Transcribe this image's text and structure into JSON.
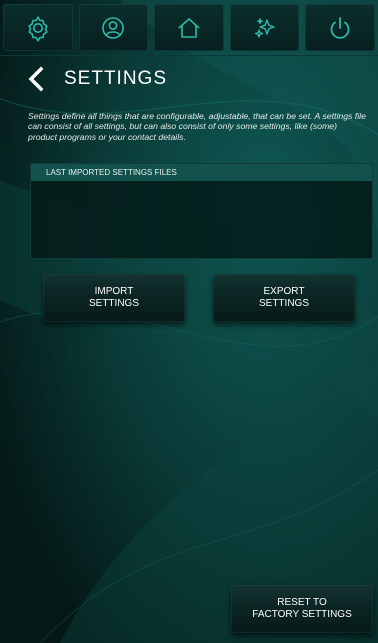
{
  "nav": {
    "items": [
      {
        "name": "gear-icon",
        "label": "Settings"
      },
      {
        "name": "user-icon",
        "label": "Profile"
      },
      {
        "name": "home-icon",
        "label": "Home"
      },
      {
        "name": "sparkle-icon",
        "label": "Effects"
      },
      {
        "name": "power-icon",
        "label": "Power"
      }
    ],
    "icon_color": "#2fb9aa"
  },
  "header": {
    "back_icon": "chevron-left-icon",
    "title": "SETTINGS"
  },
  "description": "Settings define all things that are configurable, adjustable, that can be set. A settings file can consist of all settings, but can also consist of only some settings, like (some) product programs or your contact details.",
  "files_panel": {
    "header": "LAST IMPORTED SETTINGS FILES",
    "items": []
  },
  "buttons": {
    "import": "IMPORT\nSETTINGS",
    "export": "EXPORT\nSETTINGS",
    "reset": "RESET TO\nFACTORY SETTINGS"
  },
  "colors": {
    "background": "#04201e",
    "accent": "#2fb9aa",
    "panel_header": "#13524c"
  }
}
